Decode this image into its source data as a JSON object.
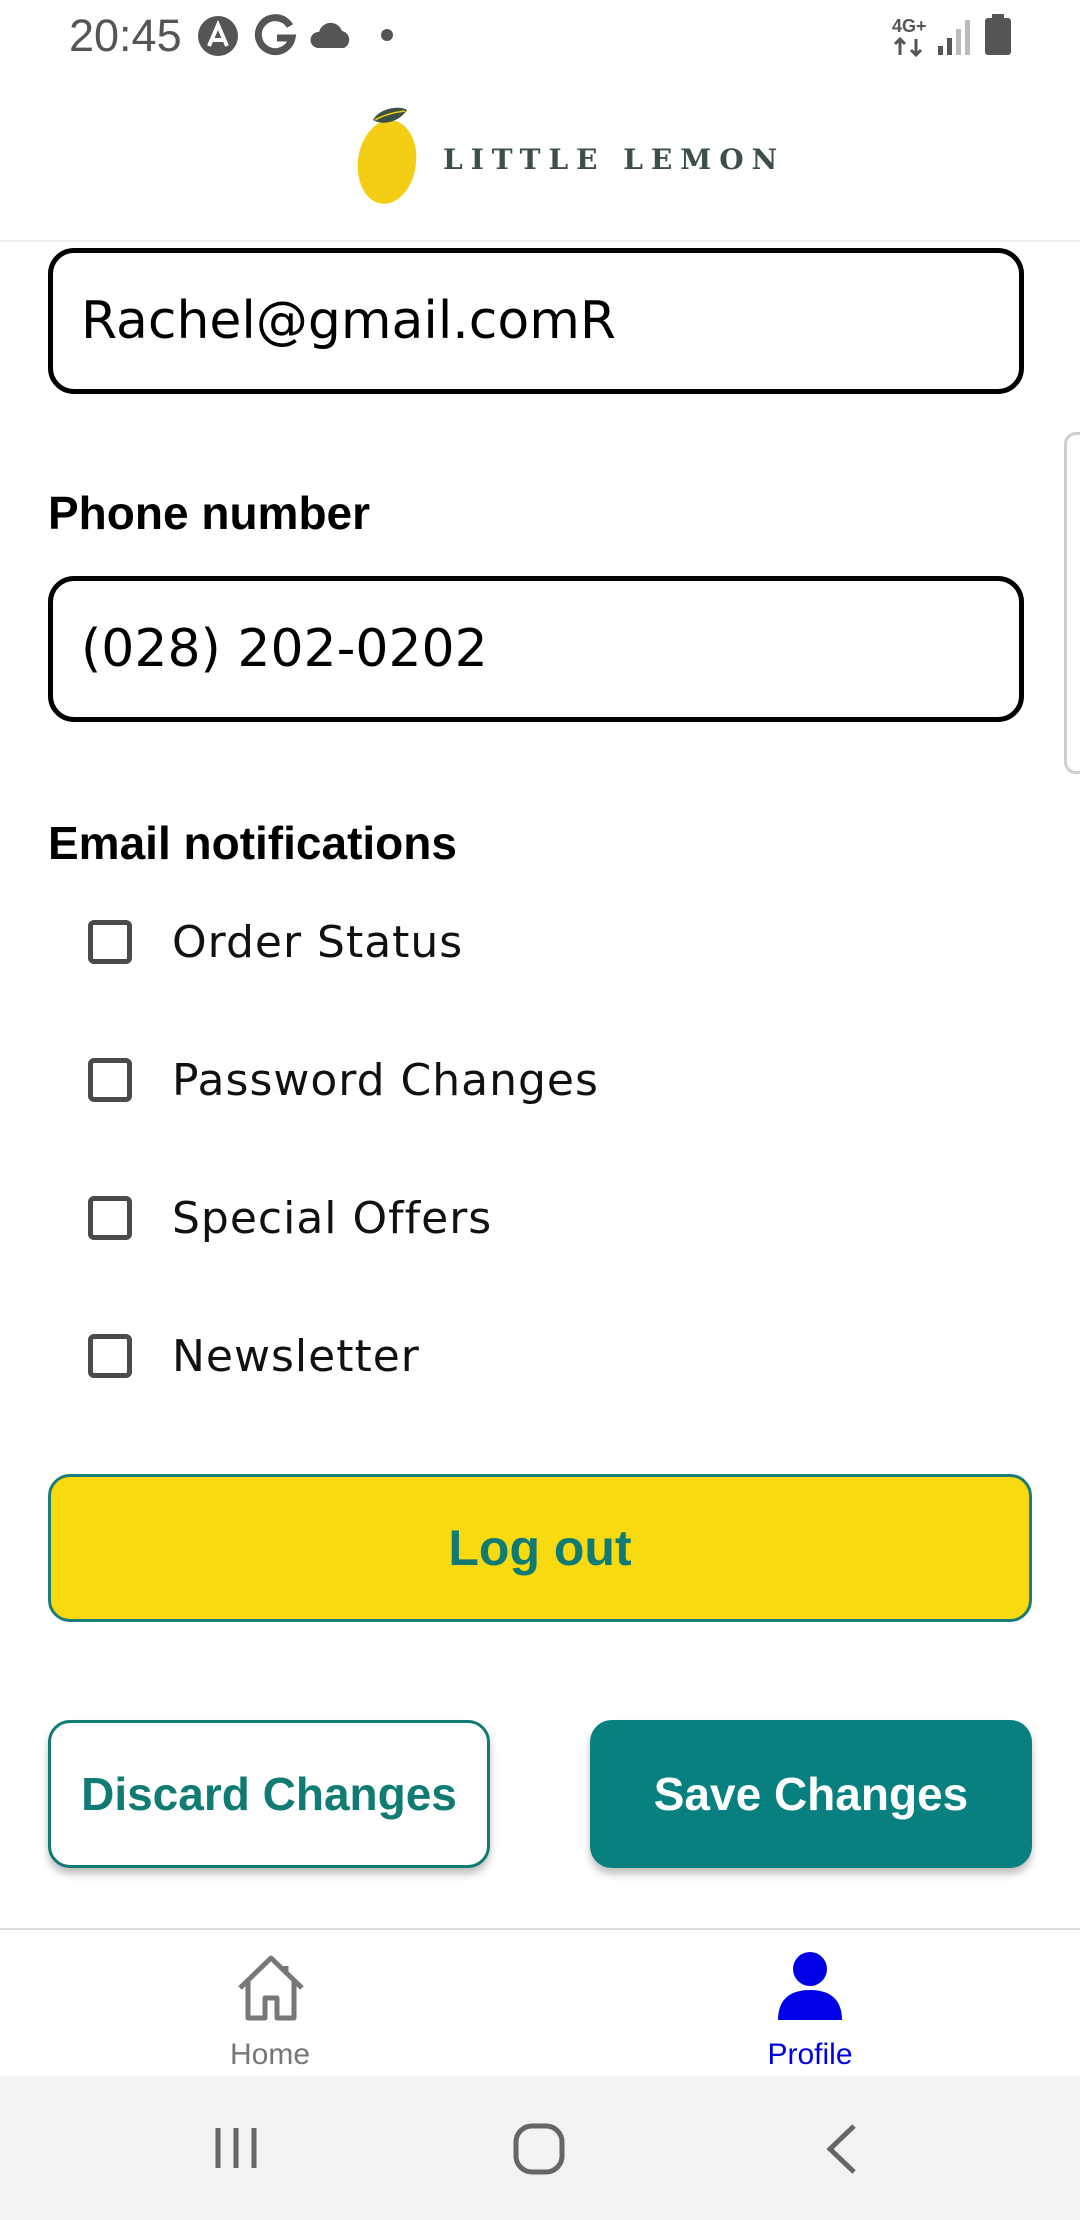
{
  "status_bar": {
    "time": "20:45",
    "left_icons": [
      "a-circle-icon",
      "google-g-icon",
      "cloud-icon",
      "dot-icon"
    ],
    "network": "4G+",
    "right_icons": [
      "network-4g-icon",
      "signal-icon",
      "battery-icon"
    ]
  },
  "header": {
    "logo_text": "LITTLE LEMON",
    "logo_colors": {
      "lemon": "#f4ce14",
      "leaf": "#3c5046"
    }
  },
  "form": {
    "email_value": "Rachel@gmail.comR",
    "phone_label": "Phone number",
    "phone_value": "(028) 202-0202"
  },
  "notifications": {
    "title": "Email notifications",
    "options": [
      {
        "label": "Order Status",
        "checked": false
      },
      {
        "label": "Password Changes",
        "checked": false
      },
      {
        "label": "Special Offers",
        "checked": false
      },
      {
        "label": "Newsletter",
        "checked": false
      }
    ]
  },
  "buttons": {
    "logout": "Log out",
    "discard": "Discard Changes",
    "save": "Save Changes"
  },
  "tabs": [
    {
      "label": "Home",
      "icon": "home-icon",
      "active": false
    },
    {
      "label": "Profile",
      "icon": "person-icon",
      "active": true
    }
  ],
  "colors": {
    "primary_teal": "#088080",
    "logout_yellow": "#f9d90f",
    "active_tab": "#0000e6",
    "inactive_tab": "#777777"
  },
  "nav_bar": {
    "icons": [
      "recent-apps-icon",
      "home-circle-icon",
      "back-icon"
    ]
  }
}
